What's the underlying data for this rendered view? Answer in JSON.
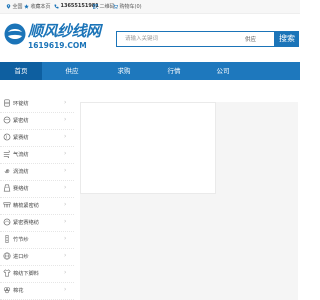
{
  "topbar": {
    "items": [
      {
        "label": "全国",
        "icon": "location-icon"
      },
      {
        "label": "收藏本页",
        "icon": "star-icon"
      },
      {
        "label": "13655151981",
        "icon": "phone-icon"
      },
      {
        "label": "二维码",
        "icon": "qrcode-icon"
      },
      {
        "label": "购物车(0)",
        "icon": "cart-icon"
      }
    ]
  },
  "header": {
    "logo_text": "顺风纱线网",
    "logo_sub": "1619619.COM",
    "search": {
      "placeholder": "请输入关键词",
      "type_label": "供应",
      "button_label": "搜索"
    }
  },
  "nav": {
    "items": [
      {
        "label": "首页"
      },
      {
        "label": "供应"
      },
      {
        "label": "求购"
      },
      {
        "label": "行情"
      },
      {
        "label": "公司"
      }
    ]
  },
  "sidebar": {
    "categories": [
      {
        "label": "环锭纺"
      },
      {
        "label": "紧密纺"
      },
      {
        "label": "紧赛纺"
      },
      {
        "label": "气流纺"
      },
      {
        "label": "涡流纺"
      },
      {
        "label": "赛络纺"
      },
      {
        "label": "精梳紧密纺"
      },
      {
        "label": "紧密赛络纺"
      },
      {
        "label": "竹节纱"
      },
      {
        "label": "进口纱"
      },
      {
        "label": "棉纺下脚料"
      },
      {
        "label": "棉花"
      }
    ]
  },
  "colors": {
    "brand": "#1b74b8",
    "nav_bg": "#1e78bd",
    "nav_active": "#0e5fa0"
  }
}
